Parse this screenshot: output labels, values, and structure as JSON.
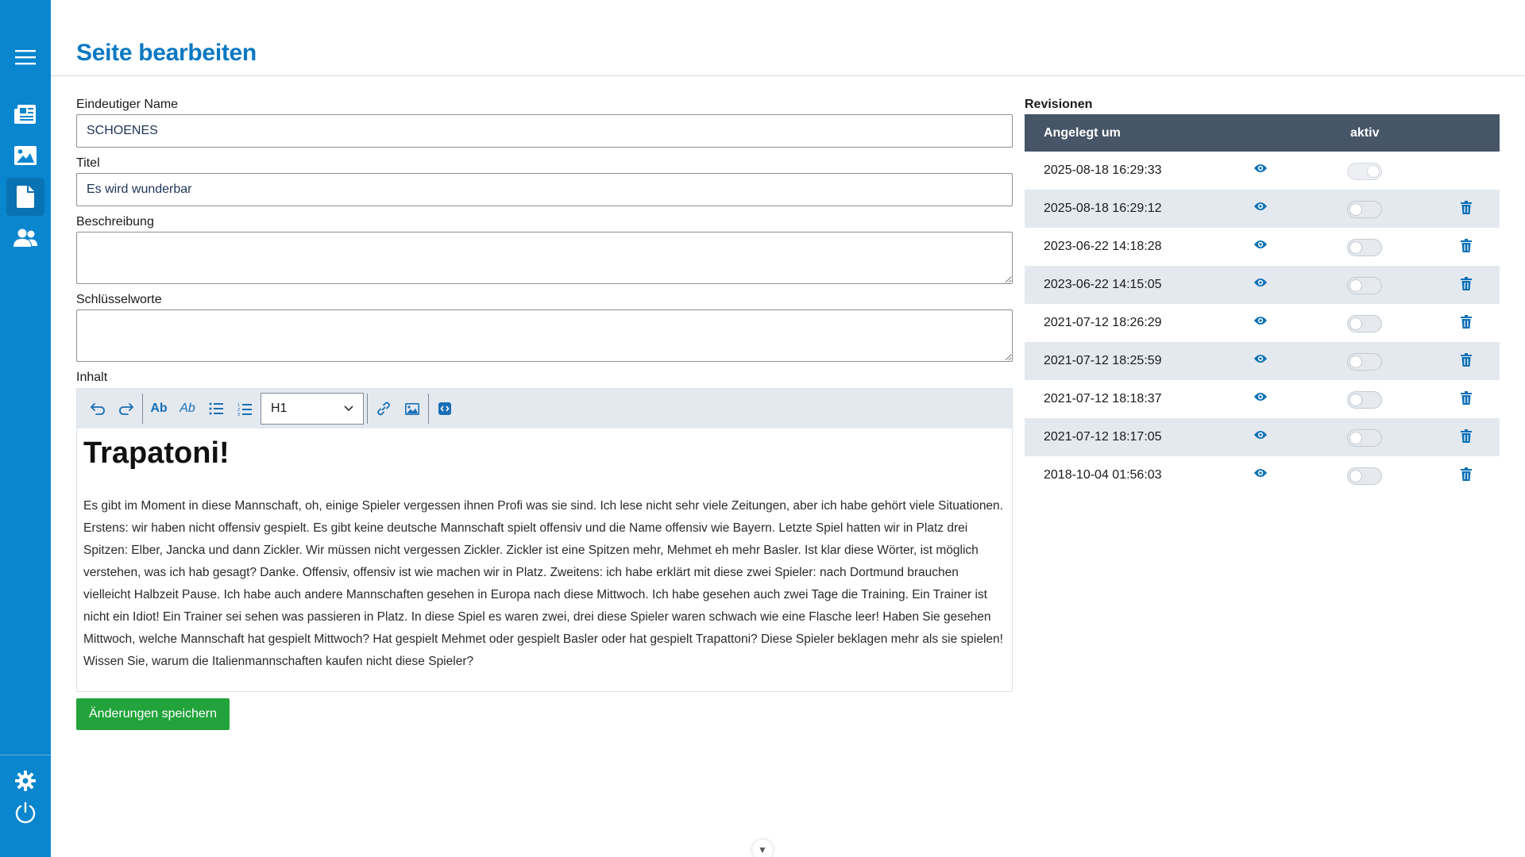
{
  "header": {
    "title": "Seite bearbeiten"
  },
  "sidebar": {
    "items": [
      {
        "icon": "menu-icon"
      },
      {
        "icon": "newspaper-icon"
      },
      {
        "icon": "image-icon"
      },
      {
        "icon": "file-icon",
        "active": true
      },
      {
        "icon": "users-icon"
      }
    ],
    "bottom": [
      {
        "icon": "gear-icon"
      },
      {
        "icon": "power-icon"
      }
    ]
  },
  "form": {
    "name_label": "Eindeutiger Name",
    "name_value": "SCHOENES",
    "title_label": "Titel",
    "title_value": "Es wird wunderbar",
    "description_label": "Beschreibung",
    "description_value": "",
    "keywords_label": "Schlüsselworte",
    "keywords_value": "",
    "content_label": "Inhalt"
  },
  "editor": {
    "heading_select": "H1",
    "bold_label": "Ab",
    "italic_label": "Ab",
    "content_heading": "Trapatoni!",
    "content_paragraph": "Es gibt im Moment in diese Mannschaft, oh, einige Spieler vergessen ihnen Profi was sie sind. Ich lese nicht sehr viele Zeitungen, aber ich habe gehört viele Situationen. Erstens: wir haben nicht offensiv gespielt. Es gibt keine deutsche Mannschaft spielt offensiv und die Name offensiv wie Bayern. Letzte Spiel hatten wir in Platz drei Spitzen: Elber, Jancka und dann Zickler. Wir müssen nicht vergessen Zickler. Zickler ist eine Spitzen mehr, Mehmet eh mehr Basler. Ist klar diese Wörter, ist möglich verstehen, was ich hab gesagt? Danke. Offensiv, offensiv ist wie machen wir in Platz. Zweitens: ich habe erklärt mit diese zwei Spieler: nach Dortmund brauchen vielleicht Halbzeit Pause. Ich habe auch andere Mannschaften gesehen in Europa nach diese Mittwoch. Ich habe gesehen auch zwei Tage die Training. Ein Trainer ist nicht ein Idiot! Ein Trainer sei sehen was passieren in Platz. In diese Spiel es waren zwei, drei diese Spieler waren schwach wie eine Flasche leer! Haben Sie gesehen Mittwoch, welche Mannschaft hat gespielt Mittwoch? Hat gespielt Mehmet oder gespielt Basler oder hat gespielt Trapattoni? Diese Spieler beklagen mehr als sie spielen! Wissen Sie, warum die Italienmannschaften kaufen nicht diese Spieler?"
  },
  "actions": {
    "save_label": "Änderungen speichern"
  },
  "revisions": {
    "title": "Revisionen",
    "col_created": "Angelegt um",
    "col_active": "aktiv",
    "rows": [
      {
        "date": "2025-08-18 16:29:33",
        "active": true
      },
      {
        "date": "2025-08-18 16:29:12",
        "active": false
      },
      {
        "date": "2023-06-22 14:18:28",
        "active": false
      },
      {
        "date": "2023-06-22 14:15:05",
        "active": false
      },
      {
        "date": "2021-07-12 18:26:29",
        "active": false
      },
      {
        "date": "2021-07-12 18:25:59",
        "active": false
      },
      {
        "date": "2021-07-12 18:18:37",
        "active": false
      },
      {
        "date": "2021-07-12 18:17:05",
        "active": false
      },
      {
        "date": "2018-10-04 01:56:03",
        "active": false
      }
    ]
  },
  "colors": {
    "sidebar": "#0a86cf",
    "title": "#0a78c2",
    "table_header": "#465568",
    "save_button": "#22a33c",
    "icon_blue": "#0a6fb5"
  }
}
